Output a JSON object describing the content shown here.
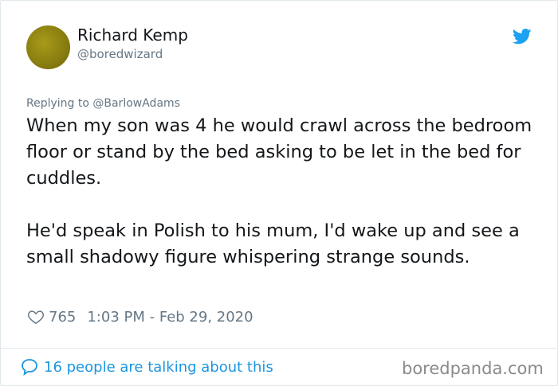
{
  "author": {
    "name": "Richard Kemp",
    "handle": "@boredwizard"
  },
  "reply_context": "Replying to @BarlowAdams",
  "paragraphs": [
    "When my son was 4 he would crawl across the bedroom floor or stand by the bed asking to be let in the bed for cuddles.",
    "He'd speak in Polish to his mum, I'd wake up and see a small shadowy figure whispering strange sounds."
  ],
  "meta": {
    "likes": "765",
    "timestamp": "1:03 PM - Feb 29, 2020"
  },
  "conversation": "16 people are talking about this",
  "watermark": "boredpanda.com",
  "colors": {
    "twitter_blue": "#1da1f2",
    "link_blue": "#1b95e0",
    "secondary_text": "#657786"
  },
  "icons": {
    "brand": "twitter-bird-icon",
    "like": "heart-icon",
    "conversation": "speech-bubble-icon"
  }
}
